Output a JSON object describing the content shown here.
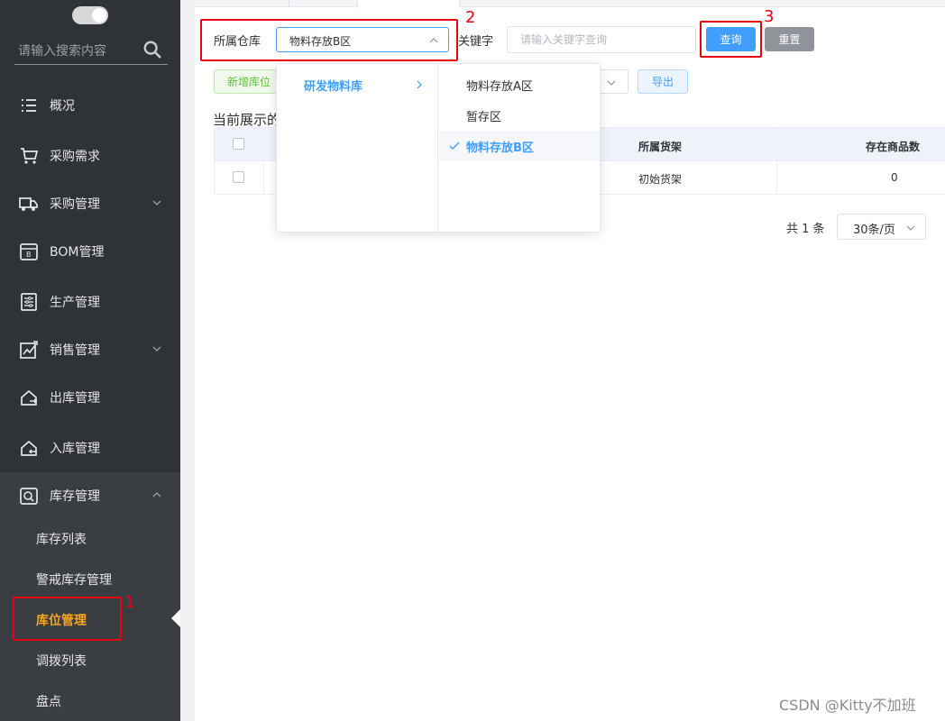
{
  "sidebar": {
    "search_placeholder": "请输入搜索内容",
    "menu": [
      {
        "label": "概况",
        "icon": "list-icon"
      },
      {
        "label": "采购需求",
        "icon": "cart-icon"
      },
      {
        "label": "采购管理",
        "icon": "truck-icon",
        "expandable": true
      },
      {
        "label": "BOM管理",
        "icon": "bom-icon"
      },
      {
        "label": "生产管理",
        "icon": "production-icon"
      },
      {
        "label": "销售管理",
        "icon": "sales-icon",
        "expandable": true
      },
      {
        "label": "出库管理",
        "icon": "outbound-icon"
      },
      {
        "label": "入库管理",
        "icon": "inbound-icon"
      },
      {
        "label": "库存管理",
        "icon": "inventory-icon",
        "expanded": true
      }
    ],
    "submenu": [
      {
        "label": "库存列表"
      },
      {
        "label": "警戒库存管理"
      },
      {
        "label": "库位管理",
        "active": true
      },
      {
        "label": "调拨列表"
      },
      {
        "label": "盘点"
      }
    ]
  },
  "filter": {
    "warehouse_label": "所属仓库",
    "warehouse_value": "物料存放B区",
    "keyword_label": "关键字",
    "keyword_placeholder": "请输入关键字查询",
    "query_label": "查询",
    "reset_label": "重置"
  },
  "toolbar": {
    "add_label": "新增库位",
    "export_label": "导出"
  },
  "showing_text": "当前展示的",
  "table": {
    "columns": [
      "所属货架",
      "存在商品数"
    ],
    "rows": [
      {
        "shelf": "初始货架",
        "count": "0"
      }
    ]
  },
  "pagination": {
    "total": "共 1 条",
    "page_size": "30条/页"
  },
  "cascader": {
    "level1": [
      {
        "label": "研发物料库",
        "active": true
      }
    ],
    "level2": [
      {
        "label": "物料存放A区"
      },
      {
        "label": "暂存区"
      },
      {
        "label": "物料存放B区",
        "selected": true
      }
    ]
  },
  "annotations": {
    "n1": "1",
    "n2": "2",
    "n3": "3"
  },
  "watermark": "CSDN @Kitty不加班",
  "colors": {
    "primary": "#409eff",
    "sidebar_bg": "#2f3236",
    "active_menu": "#f5a623",
    "annotation": "#e60012"
  }
}
